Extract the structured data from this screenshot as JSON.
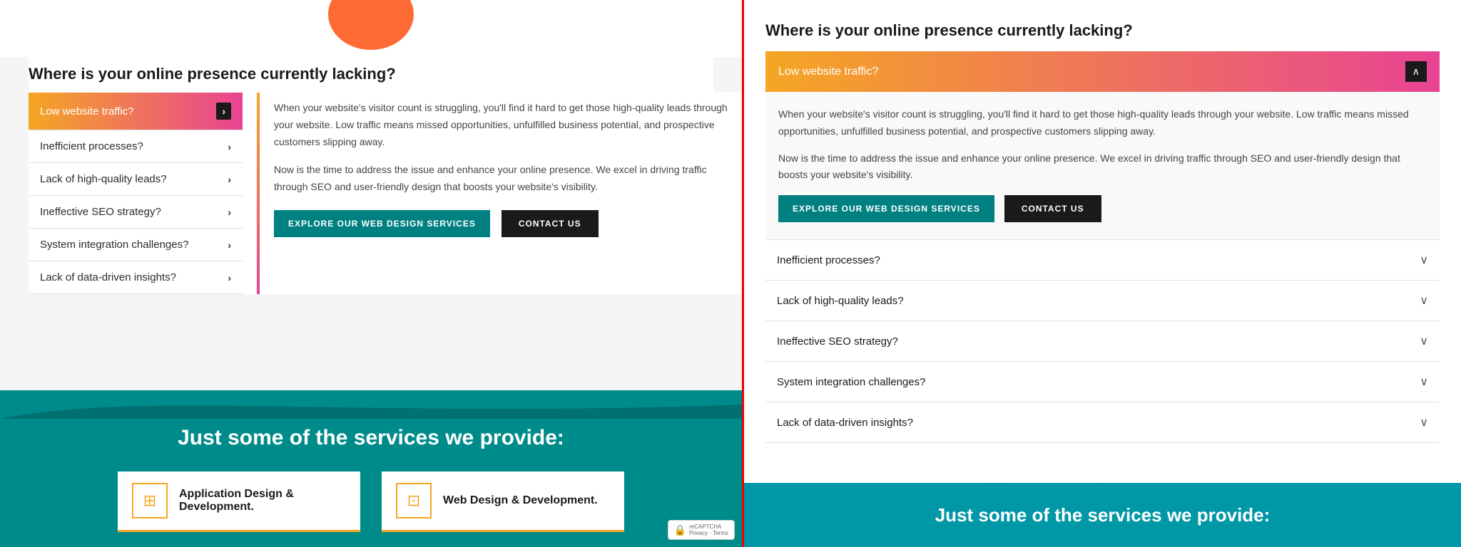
{
  "left": {
    "section_title": "Where is your online presence currently lacking?",
    "active_item": "Low website traffic?",
    "accordion_items": [
      {
        "label": "Low website traffic?",
        "active": true
      },
      {
        "label": "Inefficient processes?",
        "active": false
      },
      {
        "label": "Lack of high-quality leads?",
        "active": false
      },
      {
        "label": "Ineffective SEO strategy?",
        "active": false
      },
      {
        "label": "System integration challenges?",
        "active": false
      },
      {
        "label": "Lack of data-driven insights?",
        "active": false
      }
    ],
    "content_para1": "When your website's visitor count is struggling, you'll find it hard to get those high-quality leads through your website. Low traffic means missed opportunities, unfulfilled business potential, and prospective customers slipping away.",
    "content_para2": "Now is the time to address the issue and enhance your online presence. We excel in driving traffic through SEO and user-friendly design that boosts your website's visibility.",
    "btn_explore": "EXPLORE OUR WEB DESIGN SERVICES",
    "btn_contact": "CONTACT US",
    "services_title": "Just some of the services we provide:",
    "services": [
      {
        "title": "Application Design & Development.",
        "icon": "⊞"
      },
      {
        "title": "Web Design & Development.",
        "icon": "⊡"
      }
    ]
  },
  "right": {
    "section_title": "Where is your online presence currently lacking?",
    "active_item": "Low website traffic?",
    "content_para1": "When your website's visitor count is struggling, you'll find it hard to get those high-quality leads through your website. Low traffic means missed opportunities, unfulfilled business potential, and prospective customers slipping away.",
    "content_para2": "Now is the time to address the issue and enhance your online presence. We excel in driving traffic through SEO and user-friendly design that boosts your website's visibility.",
    "btn_explore": "EXPLORE OUR WEB DESIGN SERVICES",
    "btn_contact": "CONTACT US",
    "collapsed_items": [
      {
        "label": "Inefficient processes?"
      },
      {
        "label": "Lack of high-quality leads?"
      },
      {
        "label": "Ineffective SEO strategy?"
      },
      {
        "label": "System integration challenges?"
      },
      {
        "label": "Lack of data-driven insights?"
      }
    ],
    "services_title": "Just some of the services we provide:"
  }
}
